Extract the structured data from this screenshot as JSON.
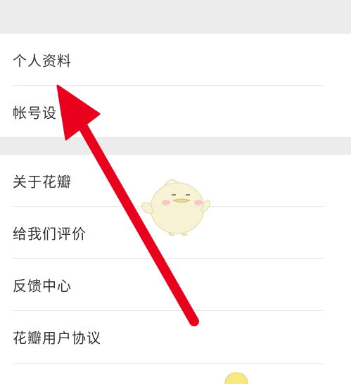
{
  "settings": {
    "items": [
      {
        "label": "个人资料"
      },
      {
        "label": "帐号设"
      },
      {
        "label": "关于花瓣"
      },
      {
        "label": "给我们评价"
      },
      {
        "label": "反馈中心"
      },
      {
        "label": "花瓣用户协议"
      }
    ]
  },
  "annotation": {
    "arrow_color": "#e8001c",
    "points_to": "个人资料"
  },
  "mascot": {
    "icon": "chick-mascot-watermark"
  },
  "colors": {
    "section_gap": "#ececec",
    "divider": "#ebebeb",
    "text": "#333333"
  }
}
